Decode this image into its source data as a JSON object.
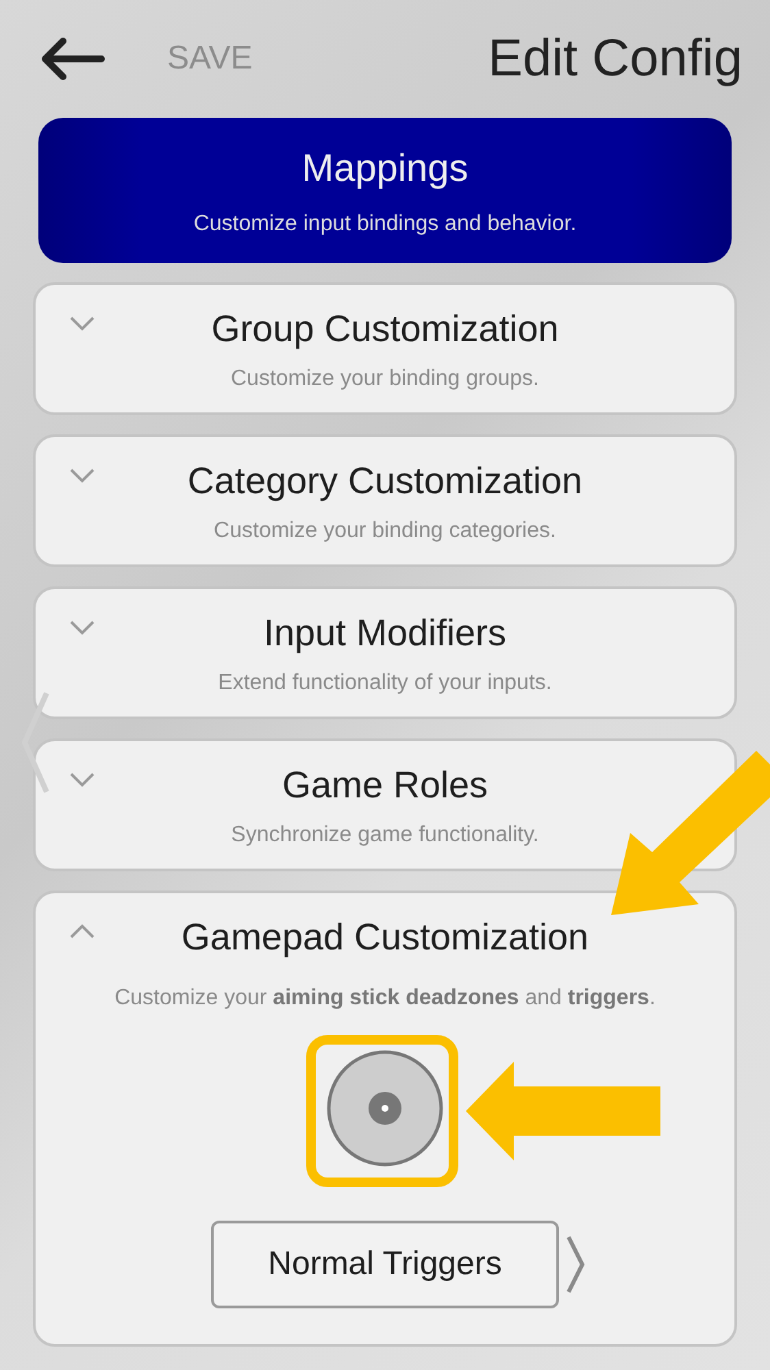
{
  "header": {
    "save": "SAVE",
    "title": "Edit Config"
  },
  "banner": {
    "title": "Mappings",
    "subtitle": "Customize input bindings and behavior."
  },
  "sections": [
    {
      "title": "Group Customization",
      "description": "Customize your binding groups.",
      "expanded": false
    },
    {
      "title": "Category Customization",
      "description": "Customize your binding categories.",
      "expanded": false
    },
    {
      "title": "Input Modifiers",
      "description": "Extend functionality of your inputs.",
      "expanded": false
    },
    {
      "title": "Game Roles",
      "description": "Synchronize game functionality.",
      "expanded": false
    },
    {
      "title": "Gamepad Customization",
      "description": "Customize your **aiming stick deadzones** and **triggers**.",
      "expanded": true,
      "trigger_button": "Normal Triggers"
    }
  ]
}
